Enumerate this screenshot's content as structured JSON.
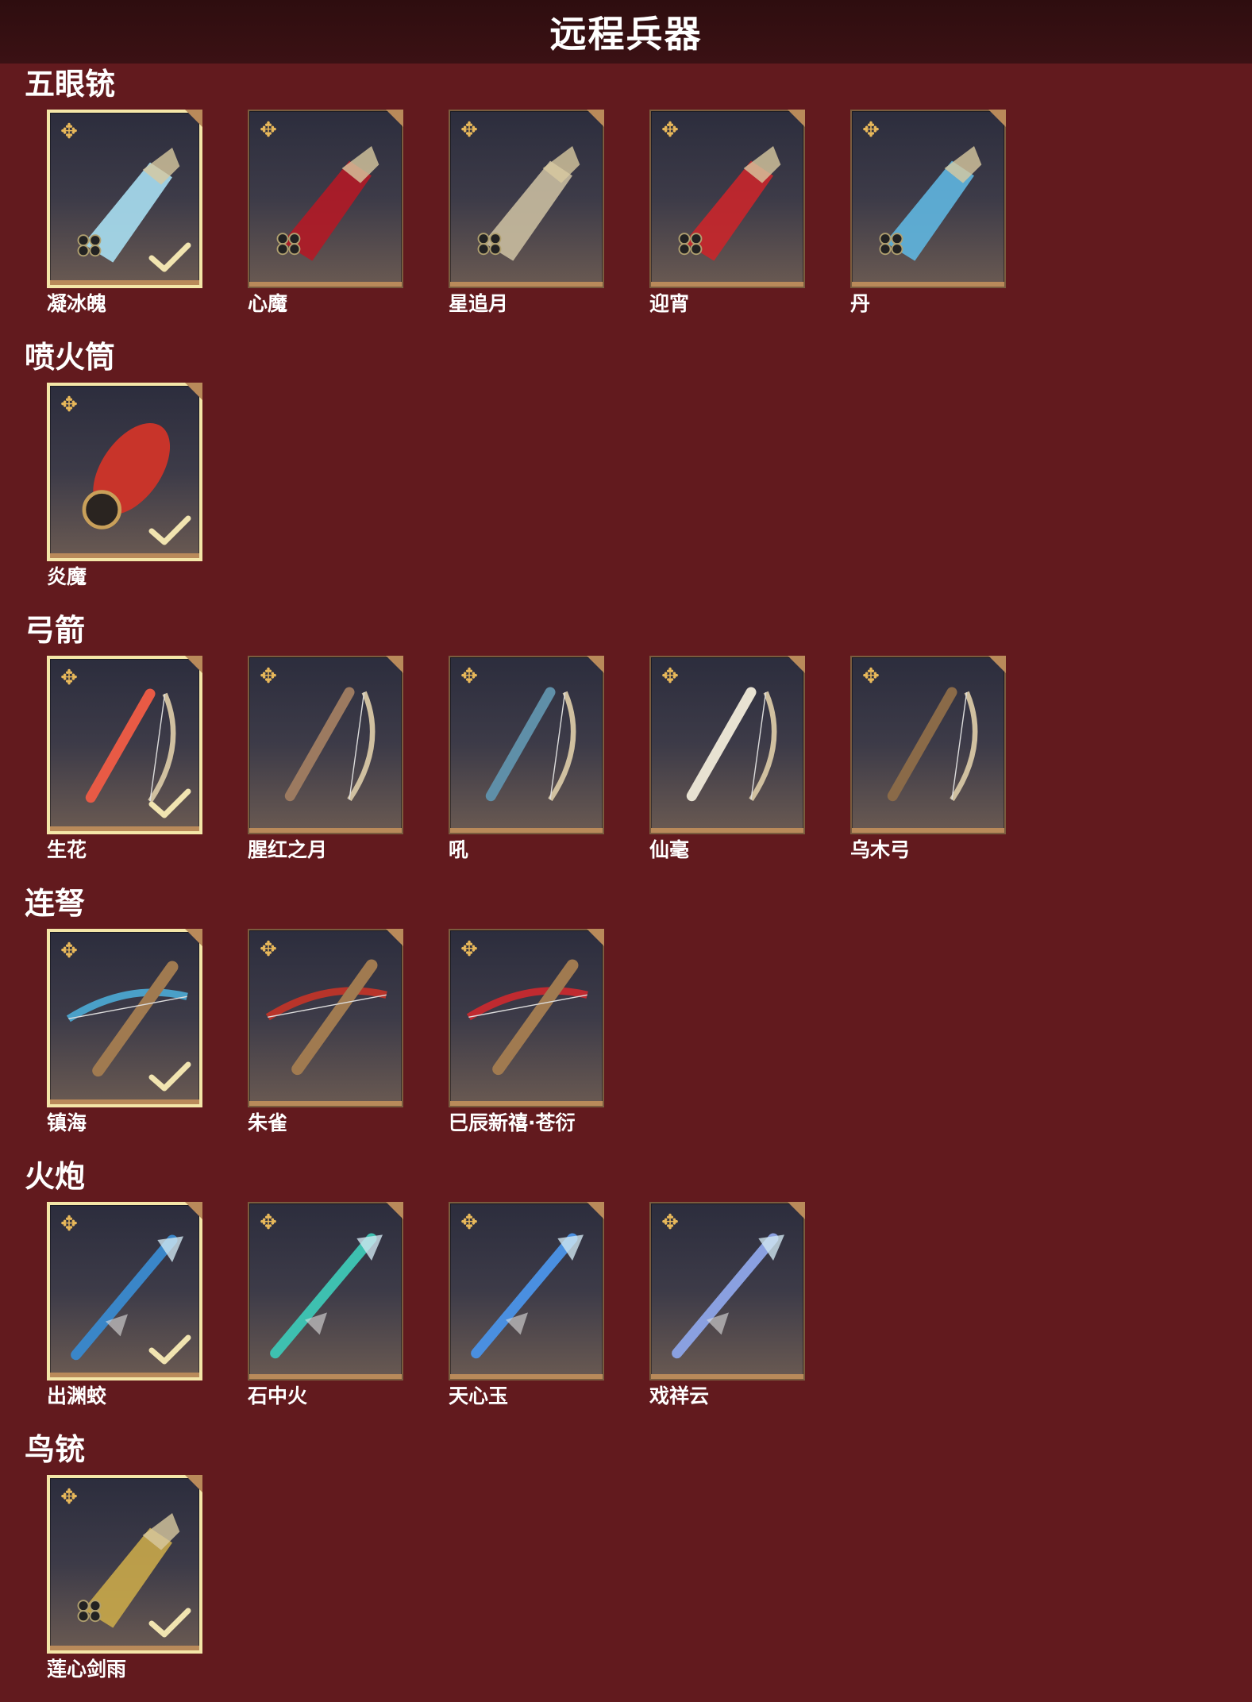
{
  "header": {
    "title": "远程兵器"
  },
  "colors": {
    "background": "#621a1e",
    "header_bg": "#2e0d0f",
    "frame": "#b98a5a",
    "selected_frame": "#f4e6a8",
    "badge": "#e8b85a"
  },
  "categories": [
    {
      "title": "五眼铳",
      "items": [
        {
          "name": "凝冰魄",
          "selected": true,
          "icon": "five-barrel-gun-ice-icon",
          "accent": "#a9dff2"
        },
        {
          "name": "心魔",
          "selected": false,
          "icon": "five-barrel-gun-demon-icon",
          "accent": "#b31a26"
        },
        {
          "name": "星追月",
          "selected": false,
          "icon": "five-barrel-gun-moon-icon",
          "accent": "#c9bda0"
        },
        {
          "name": "迎宵",
          "selected": false,
          "icon": "five-barrel-gun-festive-icon",
          "accent": "#c9262b"
        },
        {
          "name": "丹",
          "selected": false,
          "icon": "five-barrel-gun-crane-icon",
          "accent": "#5fb6e0"
        }
      ]
    },
    {
      "title": "喷火筒",
      "items": [
        {
          "name": "炎魔",
          "selected": true,
          "icon": "flamethrower-icon",
          "accent": "#c8342a"
        }
      ]
    },
    {
      "title": "弓箭",
      "items": [
        {
          "name": "生花",
          "selected": true,
          "icon": "bow-blossom-icon",
          "accent": "#e85a45"
        },
        {
          "name": "腥红之月",
          "selected": false,
          "icon": "bow-crimson-moon-icon",
          "accent": "#9c7a60"
        },
        {
          "name": "吼",
          "selected": false,
          "icon": "bow-roar-icon",
          "accent": "#5f8fa8"
        },
        {
          "name": "仙毫",
          "selected": false,
          "icon": "bow-immortal-icon",
          "accent": "#e8e2d2"
        },
        {
          "name": "乌木弓",
          "selected": false,
          "icon": "bow-ebony-icon",
          "accent": "#8a6a48"
        }
      ]
    },
    {
      "title": "连弩",
      "items": [
        {
          "name": "镇海",
          "selected": true,
          "icon": "crossbow-sea-icon",
          "accent": "#4aa0c8"
        },
        {
          "name": "朱雀",
          "selected": false,
          "icon": "crossbow-phoenix-icon",
          "accent": "#b8342a"
        },
        {
          "name": "巳辰新禧·苍衍",
          "selected": false,
          "icon": "crossbow-dragon-icon",
          "accent": "#c02a30"
        }
      ]
    },
    {
      "title": "火炮",
      "items": [
        {
          "name": "出渊蛟",
          "selected": true,
          "icon": "cannon-dragon-icon",
          "accent": "#3a86c8"
        },
        {
          "name": "石中火",
          "selected": false,
          "icon": "cannon-stone-fire-icon",
          "accent": "#3ec0b0"
        },
        {
          "name": "天心玉",
          "selected": false,
          "icon": "cannon-jade-icon",
          "accent": "#4a8fe0"
        },
        {
          "name": "戏祥云",
          "selected": false,
          "icon": "cannon-cloud-icon",
          "accent": "#8aa0e0"
        }
      ]
    },
    {
      "title": "鸟铳",
      "items": [
        {
          "name": "莲心剑雨",
          "selected": true,
          "icon": "bird-gun-lotus-icon",
          "accent": "#c9a84a"
        }
      ]
    }
  ]
}
